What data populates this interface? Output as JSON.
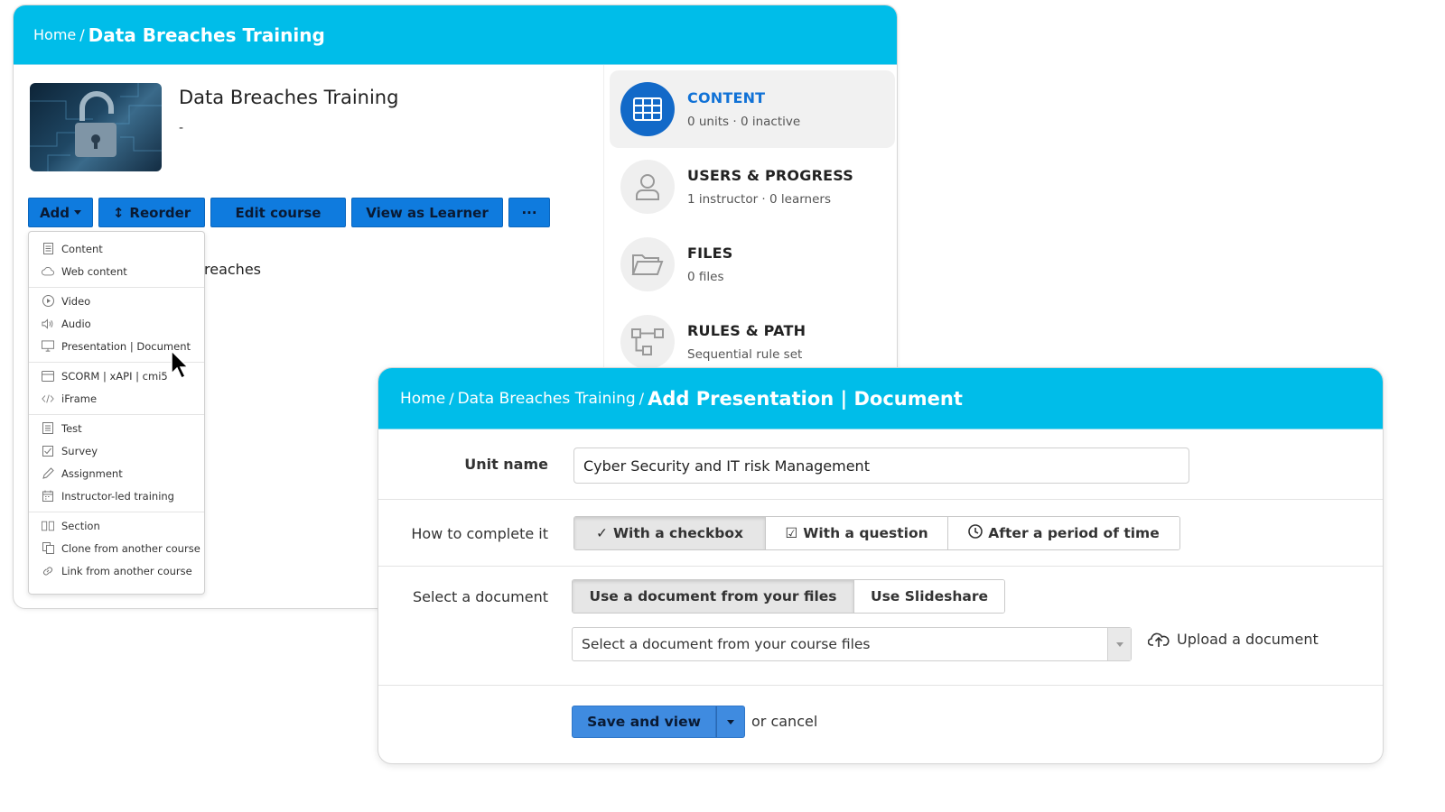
{
  "course_page": {
    "breadcrumb": {
      "home": "Home",
      "separator": "/",
      "current": "Data Breaches Training"
    },
    "course": {
      "title": "Data Breaches Training",
      "description": "-"
    },
    "toolbar": {
      "add": "Add",
      "reorder": "Reorder",
      "edit_course": "Edit course",
      "view_as_learner": "View as Learner",
      "more": "···"
    },
    "partial_text": "reaches",
    "add_menu": {
      "groups": [
        [
          {
            "label": "Content",
            "icon": "document-icon"
          },
          {
            "label": "Web content",
            "icon": "cloud-icon"
          }
        ],
        [
          {
            "label": "Video",
            "icon": "play-icon"
          },
          {
            "label": "Audio",
            "icon": "speaker-icon"
          },
          {
            "label": "Presentation | Document",
            "icon": "presentation-icon"
          }
        ],
        [
          {
            "label": "SCORM | xAPI | cmi5",
            "icon": "package-icon"
          },
          {
            "label": "iFrame",
            "icon": "code-icon"
          }
        ],
        [
          {
            "label": "Test",
            "icon": "test-icon"
          },
          {
            "label": "Survey",
            "icon": "checkbox-icon"
          },
          {
            "label": "Assignment",
            "icon": "pencil-icon"
          },
          {
            "label": "Instructor-led training",
            "icon": "calendar-icon"
          }
        ],
        [
          {
            "label": "Section",
            "icon": "section-icon"
          },
          {
            "label": "Clone from another course",
            "icon": "clone-icon"
          },
          {
            "label": "Link from another course",
            "icon": "link-icon"
          }
        ]
      ]
    },
    "sidebar": [
      {
        "title": "CONTENT",
        "subtitle": "0 units · 0 inactive",
        "icon": "grid-icon",
        "active": true
      },
      {
        "title": "USERS & PROGRESS",
        "subtitle": "1 instructor · 0 learners",
        "icon": "user-icon",
        "active": false
      },
      {
        "title": "FILES",
        "subtitle": "0 files",
        "icon": "folder-icon",
        "active": false
      },
      {
        "title": "RULES & PATH",
        "subtitle": "Sequential rule set",
        "icon": "path-icon",
        "active": false
      }
    ]
  },
  "add_dialog": {
    "breadcrumb": {
      "home": "Home",
      "separator": "/",
      "course": "Data Breaches Training",
      "current": "Add Presentation | Document"
    },
    "unit_name": {
      "label": "Unit name",
      "value": "Cyber Security and IT risk Management"
    },
    "completion": {
      "label": "How to complete it",
      "options": [
        "With a checkbox",
        "With a question",
        "After a period of time"
      ],
      "selected": "With a checkbox"
    },
    "document": {
      "label": "Select a document",
      "source_options": [
        "Use a document from your files",
        "Use Slideshare"
      ],
      "selected": "Use a document from your files",
      "select_placeholder": "Select a document from your course files",
      "upload_label": "Upload a document"
    },
    "actions": {
      "save": "Save and view",
      "cancel": "or cancel"
    }
  },
  "colors": {
    "header": "#00bde9",
    "primary_button": "#0f7bde",
    "save_button": "#3f8be0",
    "active_icon": "#1269c8",
    "active_title": "#1172d6"
  }
}
